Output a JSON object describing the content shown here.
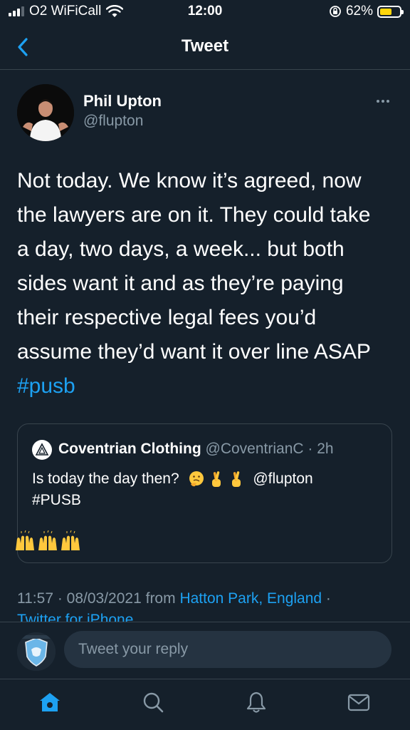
{
  "status_bar": {
    "carrier": "O2 WiFiCall",
    "time": "12:00",
    "battery_percent": "62%",
    "battery_level": 0.62,
    "battery_color": "#ffd60a",
    "icons": [
      "signal-icon",
      "wifi-icon",
      "orientation-lock-icon",
      "battery-icon"
    ]
  },
  "header": {
    "title": "Tweet",
    "back_icon": "chevron-left-icon"
  },
  "tweet": {
    "author_name": "Phil Upton",
    "author_handle": "@flupton",
    "text_lines": [
      "Not today. We know it’s agreed, now",
      "the lawyers are on it. They could take",
      "a day, two days, a week... but both",
      "sides want it and as they’re paying",
      "their respective legal fees you’d",
      "assume they’d want it over line ASAP"
    ],
    "hashtag": "#pusb",
    "timestamp": "11:57 · 08/03/2021",
    "from_word": "from",
    "location": "Hatton Park, England",
    "separator": "·",
    "source": "Twitter for iPhone"
  },
  "quoted_tweet": {
    "name": "Coventrian Clothing",
    "handle": "@CoventrianC",
    "time": "· 2h",
    "text": "Is today the day then?",
    "mention": "@flupton",
    "hashtag": "#PUSB",
    "emojis": [
      "thinking-face-emoji",
      "crossed-fingers-emoji",
      "crossed-fingers-emoji"
    ],
    "claps": [
      "raising-hands-emoji",
      "raising-hands-emoji",
      "raising-hands-emoji"
    ]
  },
  "reply": {
    "placeholder": "Tweet your reply"
  },
  "tab_bar": {
    "tabs": [
      "home-icon",
      "search-icon",
      "notifications-icon",
      "messages-icon"
    ],
    "active": "home-icon"
  },
  "colors": {
    "background": "#15202b",
    "accent": "#1da1f2",
    "muted": "#8899a6",
    "border": "#38444d"
  }
}
